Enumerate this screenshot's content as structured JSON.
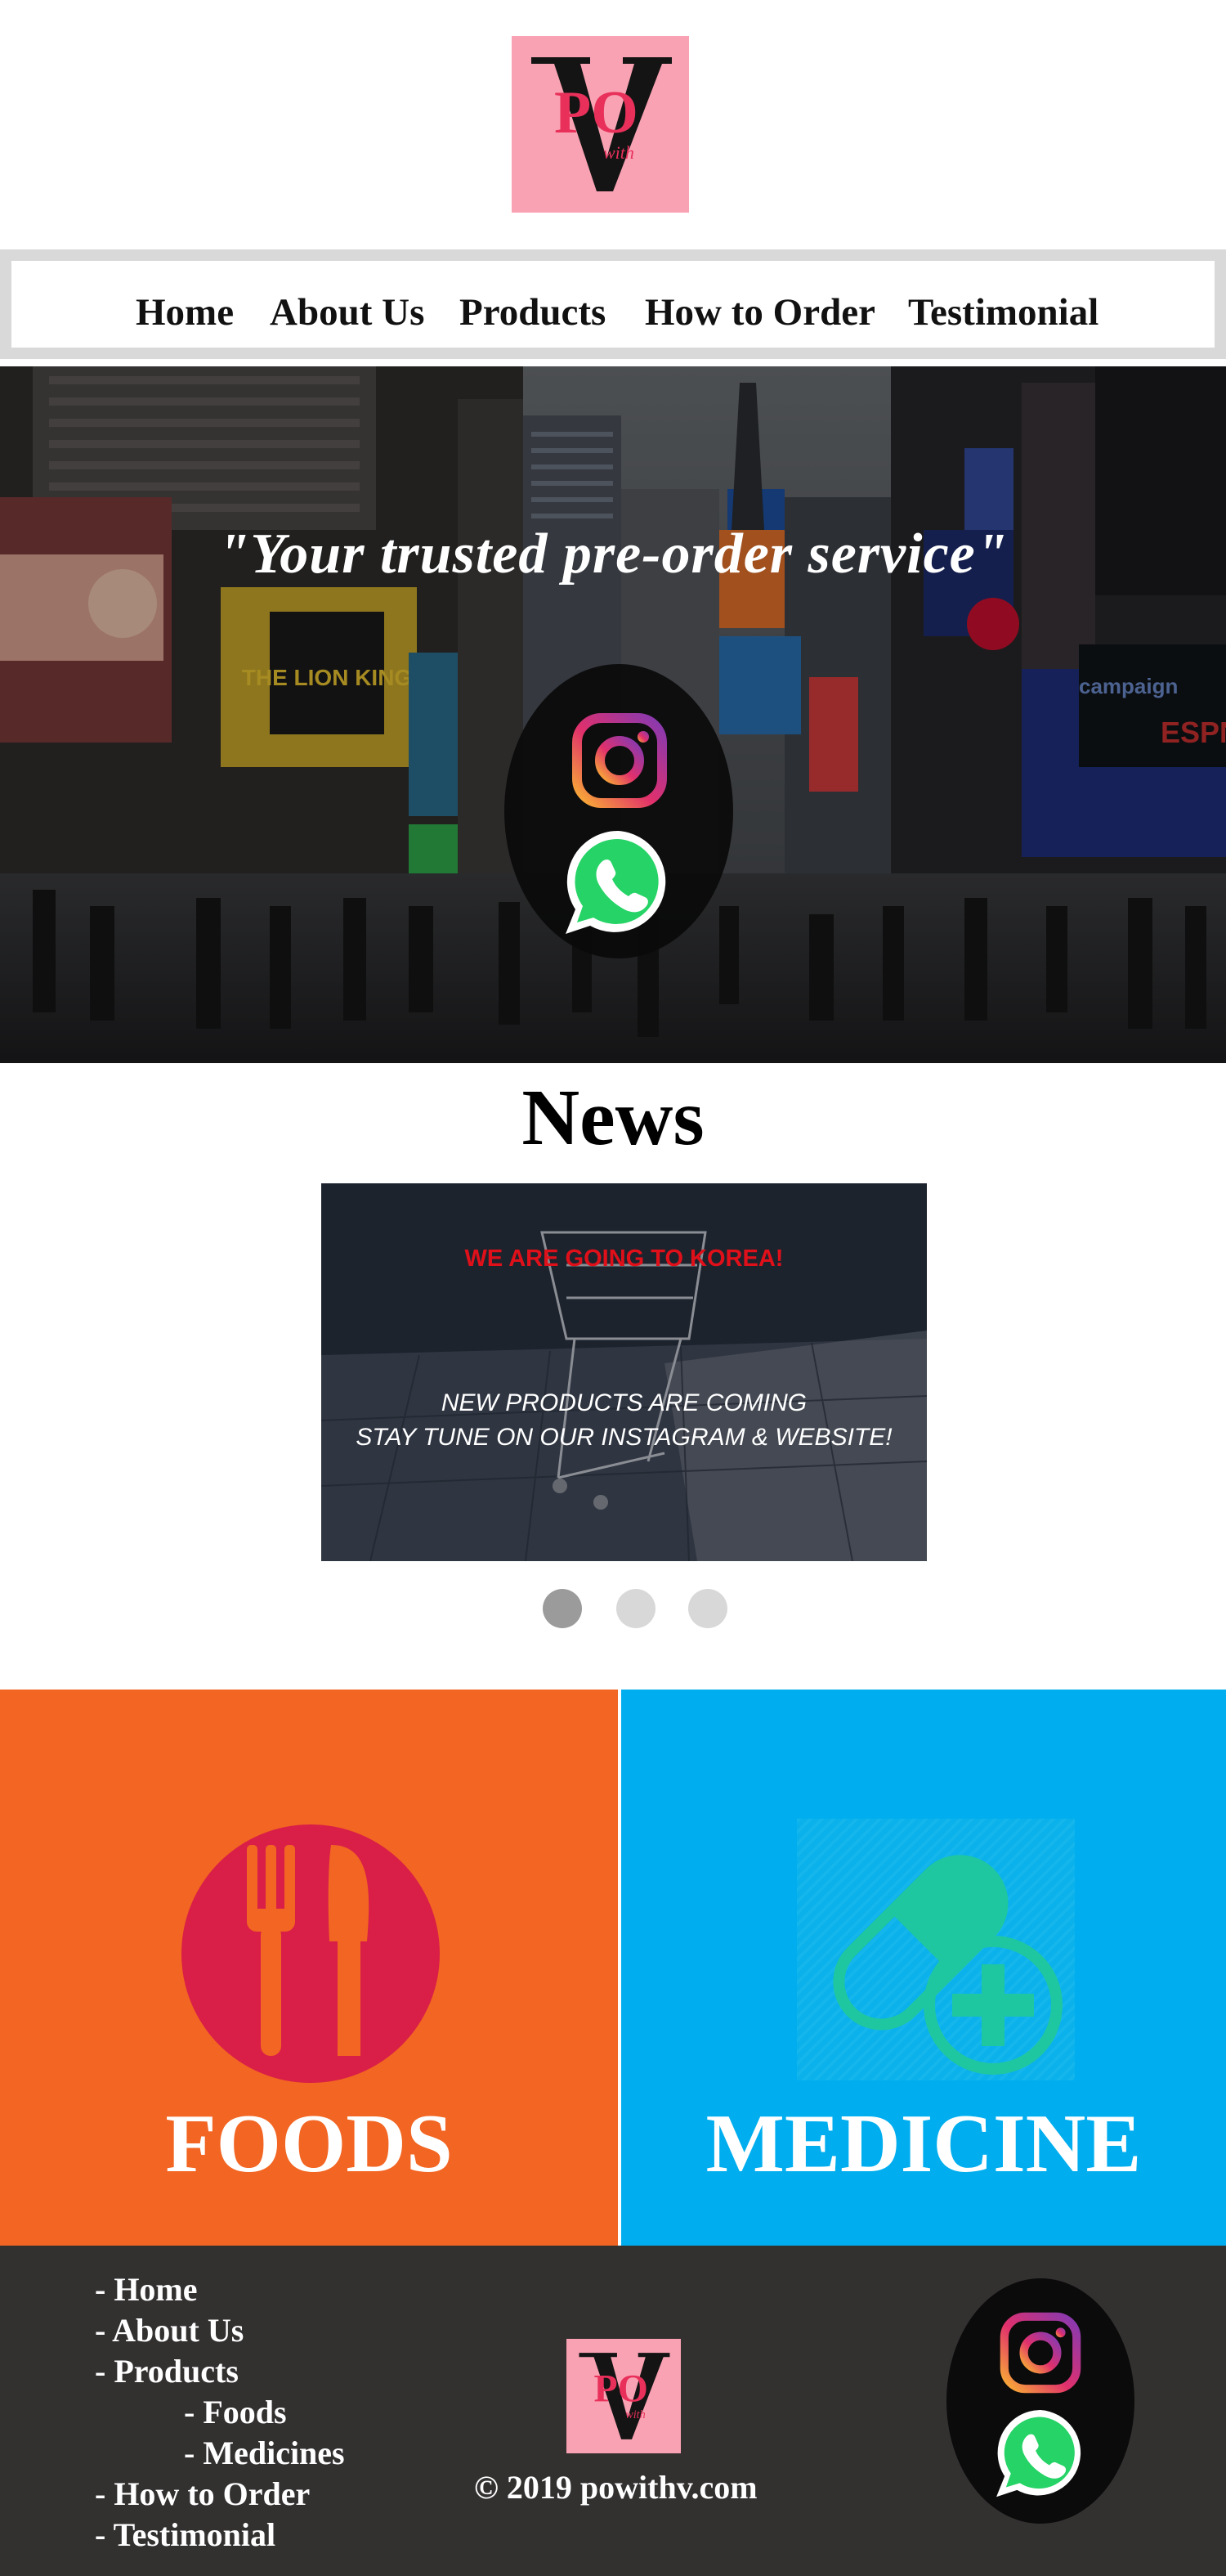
{
  "nav": {
    "items": [
      "Home",
      "About Us",
      "Products",
      "How to Order",
      "Testimonial"
    ]
  },
  "hero": {
    "tagline": "\"Your trusted pre-order service\""
  },
  "news": {
    "title": "News",
    "slide_headline": "WE ARE GOING TO KOREA!",
    "slide_line1": "NEW PRODUCTS ARE COMING",
    "slide_line2": "STAY TUNE ON OUR INSTAGRAM & WEBSITE!",
    "dot_count": 3,
    "active_dot": 1
  },
  "categories": {
    "foods_label": "FOODS",
    "medicine_label": "MEDICINE"
  },
  "footer": {
    "links": [
      "- Home",
      "- About Us",
      "- Products",
      "- Foods",
      "- Medicines",
      "- How to Order",
      "- Testimonial"
    ],
    "copyright": "© 2019 powithv.com"
  },
  "icons": [
    "instagram-icon",
    "whatsapp-icon",
    "fork-knife-icon",
    "pill-icon"
  ],
  "colors": {
    "logo_bg": "#f9a2b3",
    "foods_bg": "#f26522",
    "medicine_bg": "#00aeef",
    "footer_bg": "#333030",
    "accent_red": "#e0101a"
  }
}
